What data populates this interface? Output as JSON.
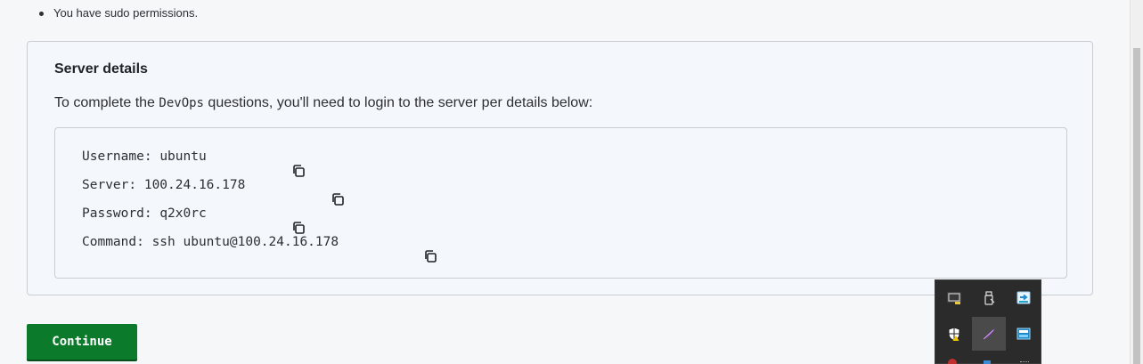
{
  "bullets": [
    "You have sudo permissions."
  ],
  "card": {
    "title": "Server details",
    "description_before": "To complete the ",
    "description_code": "DevOps",
    "description_after": " questions, you'll need to login to the server per details below:"
  },
  "details": [
    {
      "label": "Username: ",
      "value": "ubuntu",
      "copy_icon": "copy-icon"
    },
    {
      "label": "Server: ",
      "value": "100.24.16.178",
      "copy_icon": "copy-icon"
    },
    {
      "label": "Password: ",
      "value": "q2x0rc",
      "copy_icon": "copy-icon"
    },
    {
      "label": "Command: ",
      "value": "ssh ubuntu@100.24.16.178",
      "copy_icon": "copy-icon"
    }
  ],
  "continue_label": "Continue",
  "colors": {
    "continue_bg": "#0b7a2b",
    "card_bg": "#f4f7fc",
    "page_bg": "#f6f7f8"
  },
  "tray": {
    "icons": [
      "monitor-icon",
      "usb-drive-icon",
      "remote-desktop-icon",
      "shield-warning-icon",
      "feather-icon",
      "network-card-icon"
    ]
  }
}
